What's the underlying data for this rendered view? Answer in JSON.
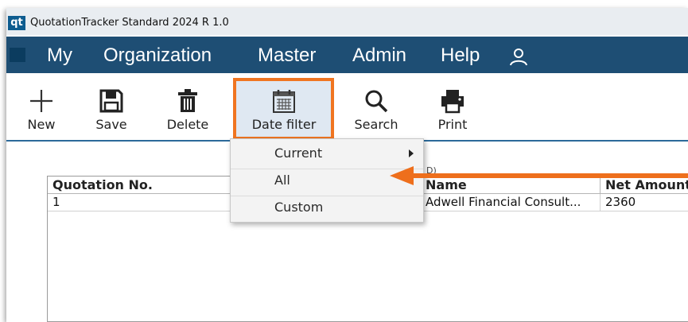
{
  "app": {
    "icon_text": "qt",
    "title": "QuotationTracker Standard 2024 R 1.0"
  },
  "menubar": {
    "items": [
      "My",
      "Organization",
      "Master",
      "Admin",
      "Help"
    ],
    "user_icon": "user-icon"
  },
  "toolbar": {
    "new_label": "New",
    "save_label": "Save",
    "delete_label": "Delete",
    "date_filter_label": "Date filter",
    "search_label": "Search",
    "print_label": "Print"
  },
  "date_filter_menu": {
    "items": [
      {
        "label": "Current",
        "has_submenu": true
      },
      {
        "label": "All",
        "has_submenu": false
      },
      {
        "label": "Custom",
        "has_submenu": false
      }
    ]
  },
  "grid": {
    "columns": [
      "Quotation No.",
      "",
      "Name",
      "Net Amount"
    ],
    "rows": [
      [
        "1",
        "",
        "Adwell Financial Consult...",
        "2360"
      ]
    ],
    "peek_text": "D)"
  },
  "colors": {
    "menubar": "#1e4e74",
    "highlight": "#f07521",
    "arrow": "#ee6f1c"
  }
}
